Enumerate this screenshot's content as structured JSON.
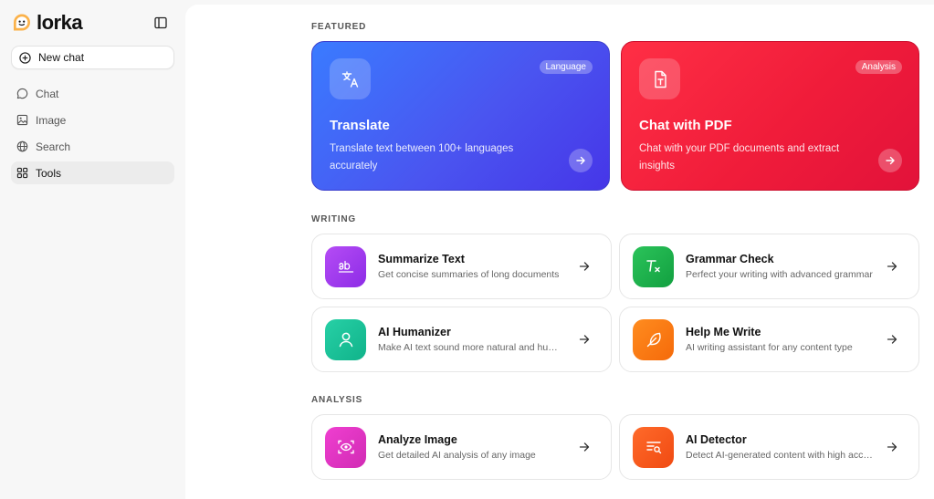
{
  "brand": {
    "name": "lorka",
    "accent": "#f2a33a"
  },
  "sidebar": {
    "new_chat": "New chat",
    "items": [
      {
        "label": "Chat",
        "icon": "chat-bubble-icon"
      },
      {
        "label": "Image",
        "icon": "image-icon"
      },
      {
        "label": "Search",
        "icon": "globe-icon"
      },
      {
        "label": "Tools",
        "icon": "grid-icon",
        "active": true
      }
    ]
  },
  "sections": {
    "featured": "FEATURED",
    "writing": "WRITING",
    "analysis": "ANALYSIS"
  },
  "featured": [
    {
      "title": "Translate",
      "badge": "Language",
      "description": "Translate text between 100+ languages accurately",
      "icon": "translate-icon",
      "color": "#4a55f0"
    },
    {
      "title": "Chat with PDF",
      "badge": "Analysis",
      "description": "Chat with your PDF documents and extract insights",
      "icon": "pdf-document-icon",
      "color": "#f01c3a"
    }
  ],
  "writing": [
    {
      "title": "Summarize Text",
      "description": "Get concise summaries of long documents",
      "icon": "summarize-icon",
      "color": "#a43bf0"
    },
    {
      "title": "Grammar Check",
      "description": "Perfect your writing with advanced grammar",
      "icon": "grammar-check-icon",
      "color": "#1fb34d"
    },
    {
      "title": "AI Humanizer",
      "description": "Make AI text sound more natural and human",
      "icon": "person-icon",
      "color": "#19c29a"
    },
    {
      "title": "Help Me Write",
      "description": "AI writing assistant for any content type",
      "icon": "feather-pen-icon",
      "color": "#ff7a12"
    }
  ],
  "analysis": [
    {
      "title": "Analyze Image",
      "description": "Get detailed AI analysis of any image",
      "icon": "eye-scan-icon",
      "color": "#e33bc8"
    },
    {
      "title": "AI Detector",
      "description": "Detect AI-generated content with high accuracy",
      "icon": "text-search-icon",
      "color": "#ff5a1f"
    }
  ]
}
